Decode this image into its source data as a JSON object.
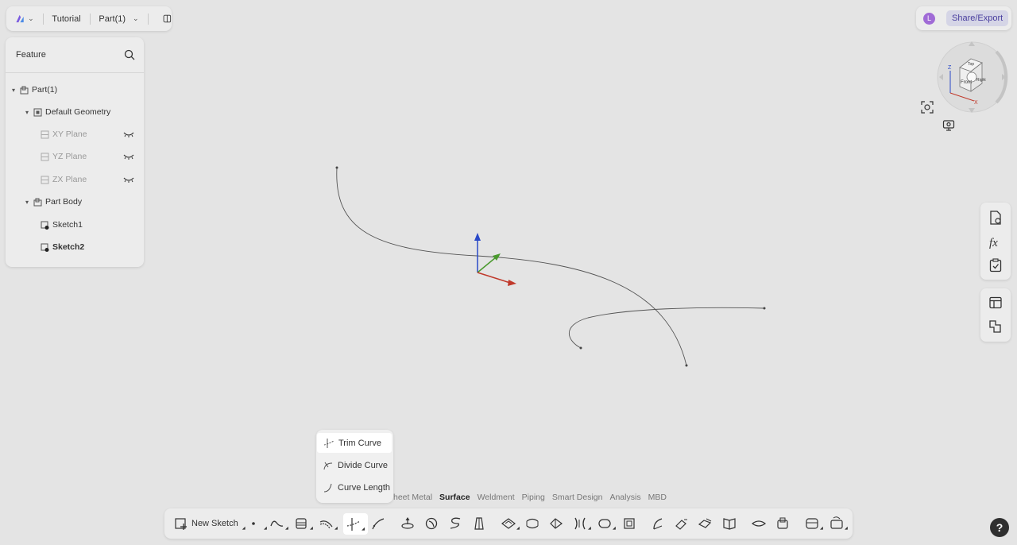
{
  "header": {
    "doc_name": "Tutorial",
    "part_name": "Part(1)"
  },
  "share": {
    "avatar_initial": "L",
    "button_label": "Share/Export"
  },
  "feature_panel": {
    "title": "Feature",
    "tree": {
      "root": "Part(1)",
      "default_geometry": "Default Geometry",
      "xy_plane": "XY Plane",
      "yz_plane": "YZ Plane",
      "zx_plane": "ZX Plane",
      "part_body": "Part Body",
      "sketch1": "Sketch1",
      "sketch2": "Sketch2"
    }
  },
  "viewcube": {
    "top": "Top",
    "front": "Front",
    "right": "Right",
    "axis_z": "Z",
    "axis_x": "X"
  },
  "tabs": [
    "Sheet Metal",
    "Surface",
    "Weldment",
    "Piping",
    "Smart Design",
    "Analysis",
    "MBD"
  ],
  "active_tab": "Surface",
  "toolbar": {
    "new_sketch": "New Sketch"
  },
  "dropdown": {
    "items": [
      "Trim Curve",
      "Divide Curve",
      "Curve Length"
    ]
  },
  "help_label": "?",
  "colors": {
    "accent": "#6a4fc8",
    "share_bg": "#d5d5e6",
    "axis_x": "#c0392b",
    "axis_y": "#4a9a2e",
    "axis_z": "#2a49c8"
  }
}
